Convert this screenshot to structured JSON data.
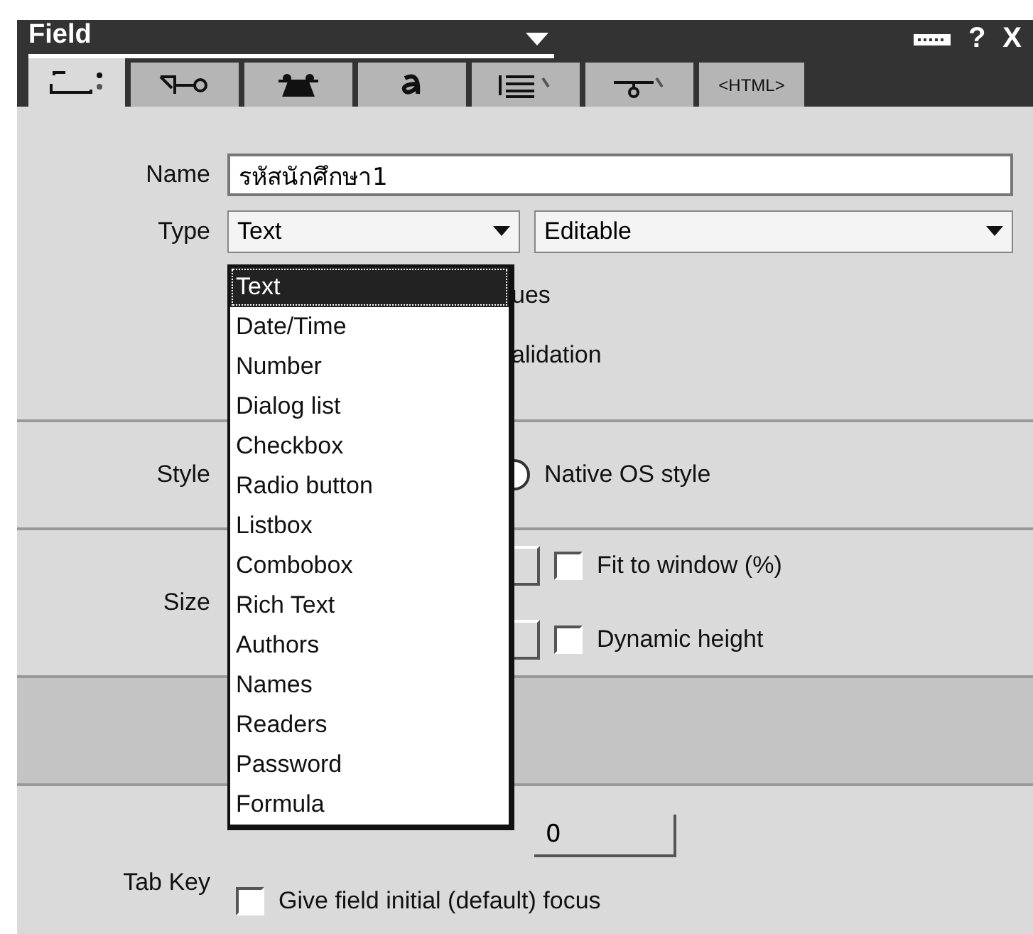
{
  "window": {
    "title": "Field",
    "controls": [
      {
        "kind": "icon"
      },
      {
        "kind": "text",
        "label": "?"
      },
      {
        "kind": "text",
        "label": "X"
      }
    ]
  },
  "tabs": [
    {
      "kind": "icon",
      "selected": true
    },
    {
      "kind": "icon",
      "selected": false
    },
    {
      "kind": "icon",
      "selected": false
    },
    {
      "kind": "icon",
      "selected": false
    },
    {
      "kind": "icon",
      "selected": false
    },
    {
      "kind": "icon",
      "selected": false
    },
    {
      "kind": "text",
      "label": "<HTML>",
      "selected": false
    }
  ],
  "name": {
    "label": "Name",
    "value": "รหัสนักศึกษา1"
  },
  "type": {
    "label": "Type",
    "value": "Text",
    "mode": "Editable"
  },
  "hidden_options": [
    "ues",
    "alidation"
  ],
  "style": {
    "label": "Style",
    "option": "Native OS style",
    "selected": false
  },
  "size": {
    "label": "Size",
    "options": [
      {
        "label": "Fit to window (%)",
        "checked": false
      },
      {
        "label": "Dynamic height",
        "checked": false
      }
    ]
  },
  "tab_key": {
    "label": "Tab Key",
    "value": "0",
    "focus": {
      "label": "Give field initial (default) focus",
      "checked": false
    }
  },
  "type_dropdown": {
    "items": [
      {
        "label": "Text",
        "selected": true
      },
      {
        "label": "Date/Time",
        "selected": false
      },
      {
        "label": "Number",
        "selected": false
      },
      {
        "label": "Dialog list",
        "selected": false
      },
      {
        "label": "Checkbox",
        "selected": false
      },
      {
        "label": "Radio button",
        "selected": false
      },
      {
        "label": "Listbox",
        "selected": false
      },
      {
        "label": "Combobox",
        "selected": false
      },
      {
        "label": "Rich Text",
        "selected": false
      },
      {
        "label": "Authors",
        "selected": false
      },
      {
        "label": "Names",
        "selected": false
      },
      {
        "label": "Readers",
        "selected": false
      },
      {
        "label": "Password",
        "selected": false
      },
      {
        "label": "Formula",
        "selected": false
      }
    ]
  }
}
